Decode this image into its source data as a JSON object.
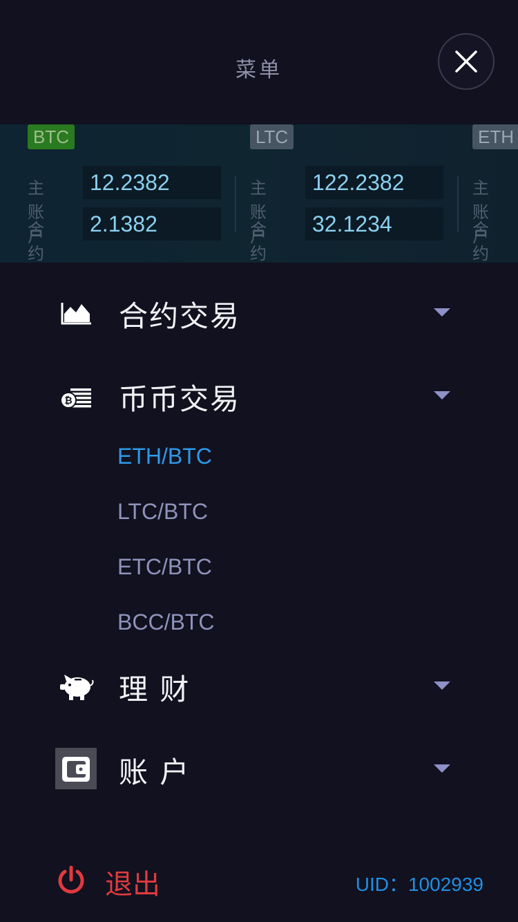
{
  "header": {
    "title": "菜单"
  },
  "balances": [
    {
      "coin": "BTC",
      "main_label": "主账户",
      "main_value": "12.2382",
      "contract_label": "合约",
      "contract_value": "2.1382"
    },
    {
      "coin": "LTC",
      "main_label": "主账户",
      "main_value": "122.2382",
      "contract_label": "合约",
      "contract_value": "32.1234"
    },
    {
      "coin": "ETH",
      "main_label": "主账户",
      "contract_label": "合约"
    }
  ],
  "menu": {
    "contract_trading": "合约交易",
    "coin_trading": "币币交易",
    "coin_pairs": [
      "ETH/BTC",
      "LTC/BTC",
      "ETC/BTC",
      "BCC/BTC"
    ],
    "finance": "理 财",
    "account": "账 户"
  },
  "footer": {
    "logout": "退出",
    "uid": "UID：1002939"
  },
  "colors": {
    "accent": "#2e9ae8",
    "danger": "#e03a3e",
    "btc_tag": "#2a7a1f"
  }
}
